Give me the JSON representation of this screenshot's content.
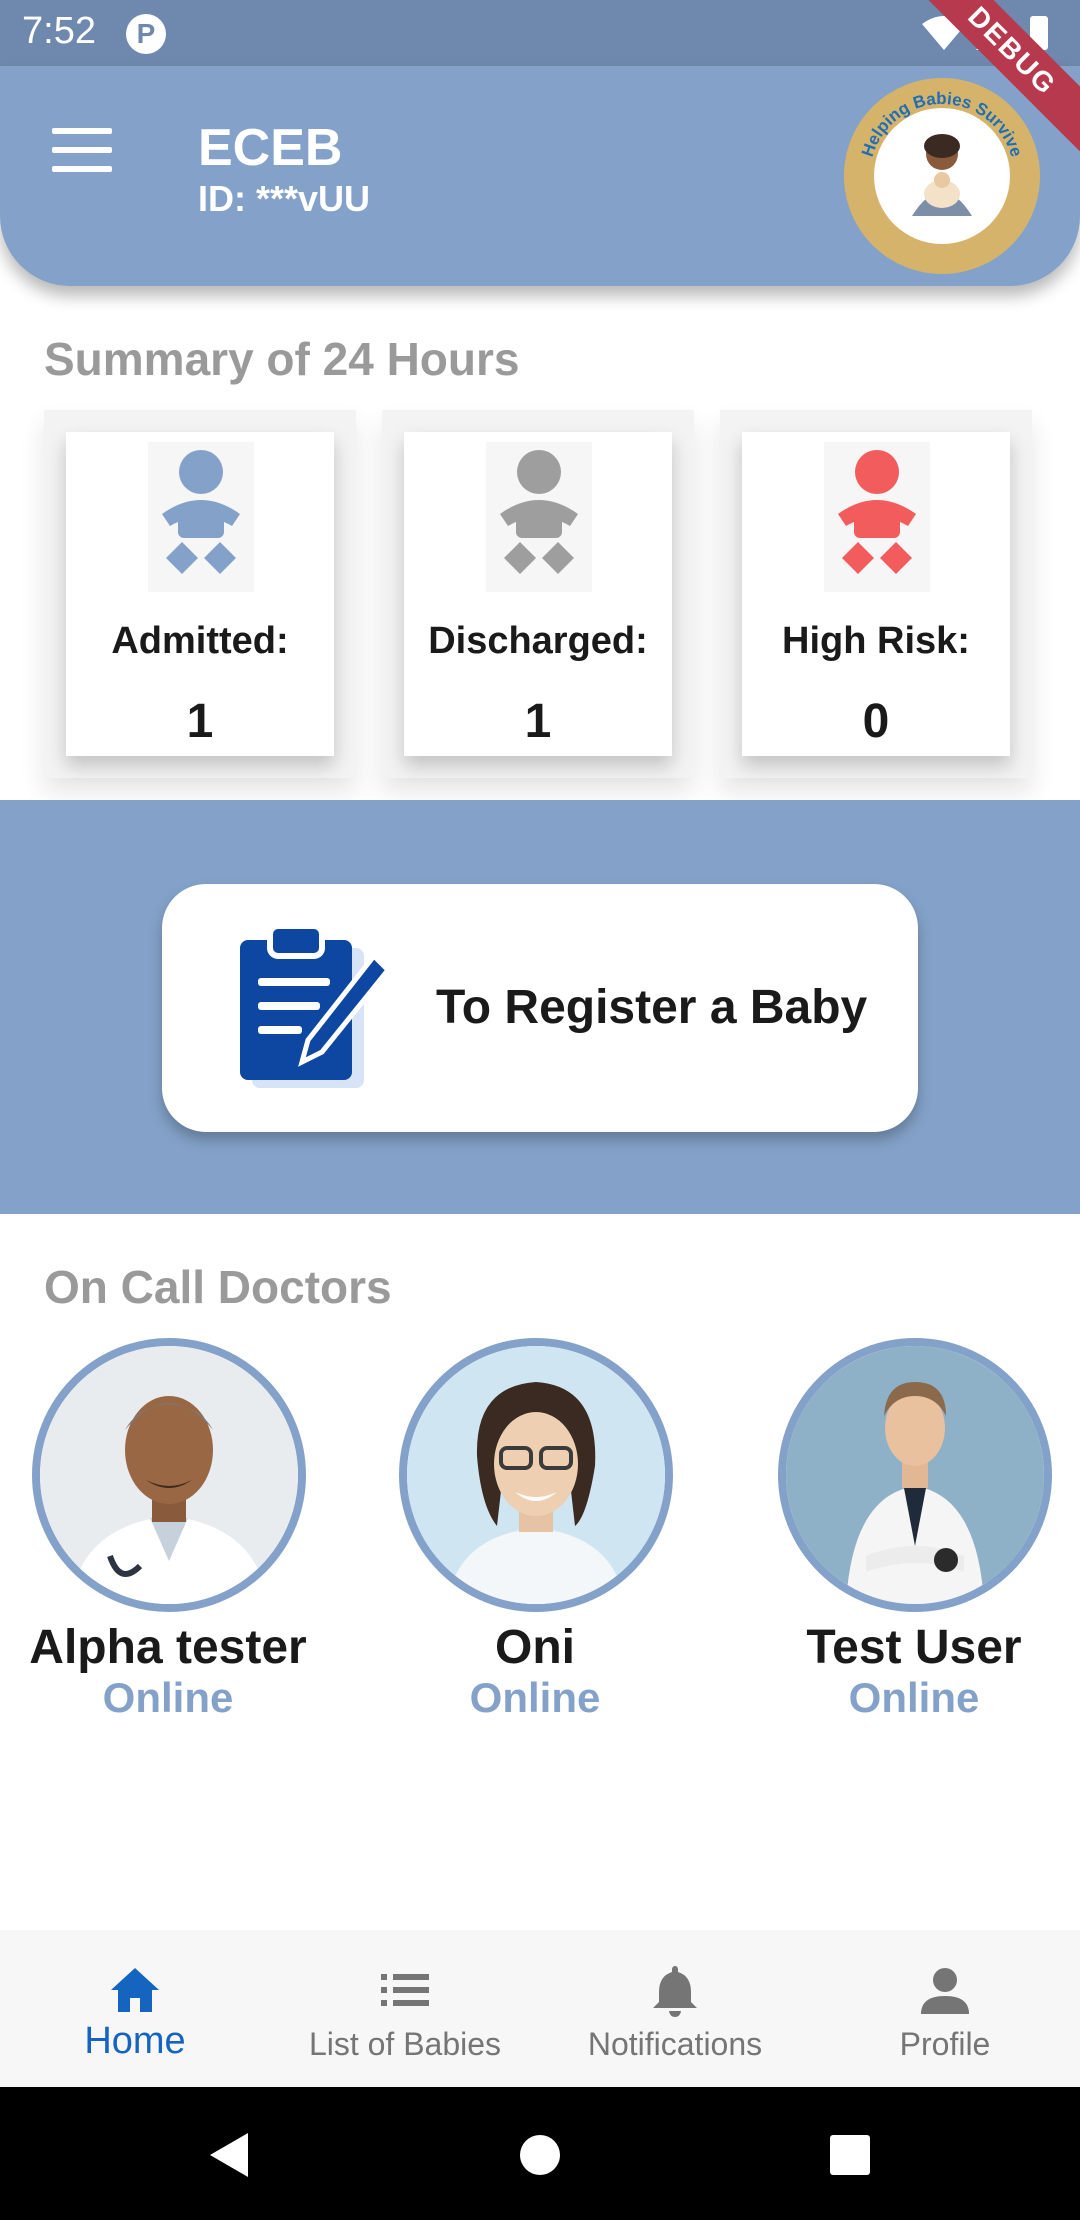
{
  "status_bar": {
    "time": "7:52",
    "app_icon_letter": "P"
  },
  "debug_banner": "DEBUG",
  "app_bar": {
    "title": "ECEB",
    "id_text": "ID: ***vUU",
    "logo_text": "Helping Babies Survive"
  },
  "summary": {
    "title": "Summary of 24 Hours",
    "cards": [
      {
        "label": "Admitted:",
        "value": "1",
        "icon": "baby-icon",
        "color": "#84a2c9"
      },
      {
        "label": "Discharged:",
        "value": "1",
        "icon": "baby-icon",
        "color": "#9e9e9e"
      },
      {
        "label": "High Risk:",
        "value": "0",
        "icon": "baby-icon",
        "color": "#f25c5c"
      }
    ]
  },
  "register": {
    "label": "To Register a Baby",
    "icon": "clipboard-edit-icon"
  },
  "doctors": {
    "title": "On Call Doctors",
    "list": [
      {
        "name": "Alpha tester",
        "status": "Online"
      },
      {
        "name": "Oni",
        "status": "Online"
      },
      {
        "name": "Test User",
        "status": "Online"
      }
    ]
  },
  "bottom_nav": {
    "items": [
      {
        "label": "Home",
        "icon": "home-icon",
        "active": true
      },
      {
        "label": "List of Babies",
        "icon": "list-icon",
        "active": false
      },
      {
        "label": "Notifications",
        "icon": "bell-icon",
        "active": false
      },
      {
        "label": "Profile",
        "icon": "person-icon",
        "active": false
      }
    ]
  },
  "colors": {
    "primary": "#84a2c9",
    "active_nav": "#1565c0",
    "status_online": "#84a2c9",
    "high_risk": "#f25c5c"
  }
}
